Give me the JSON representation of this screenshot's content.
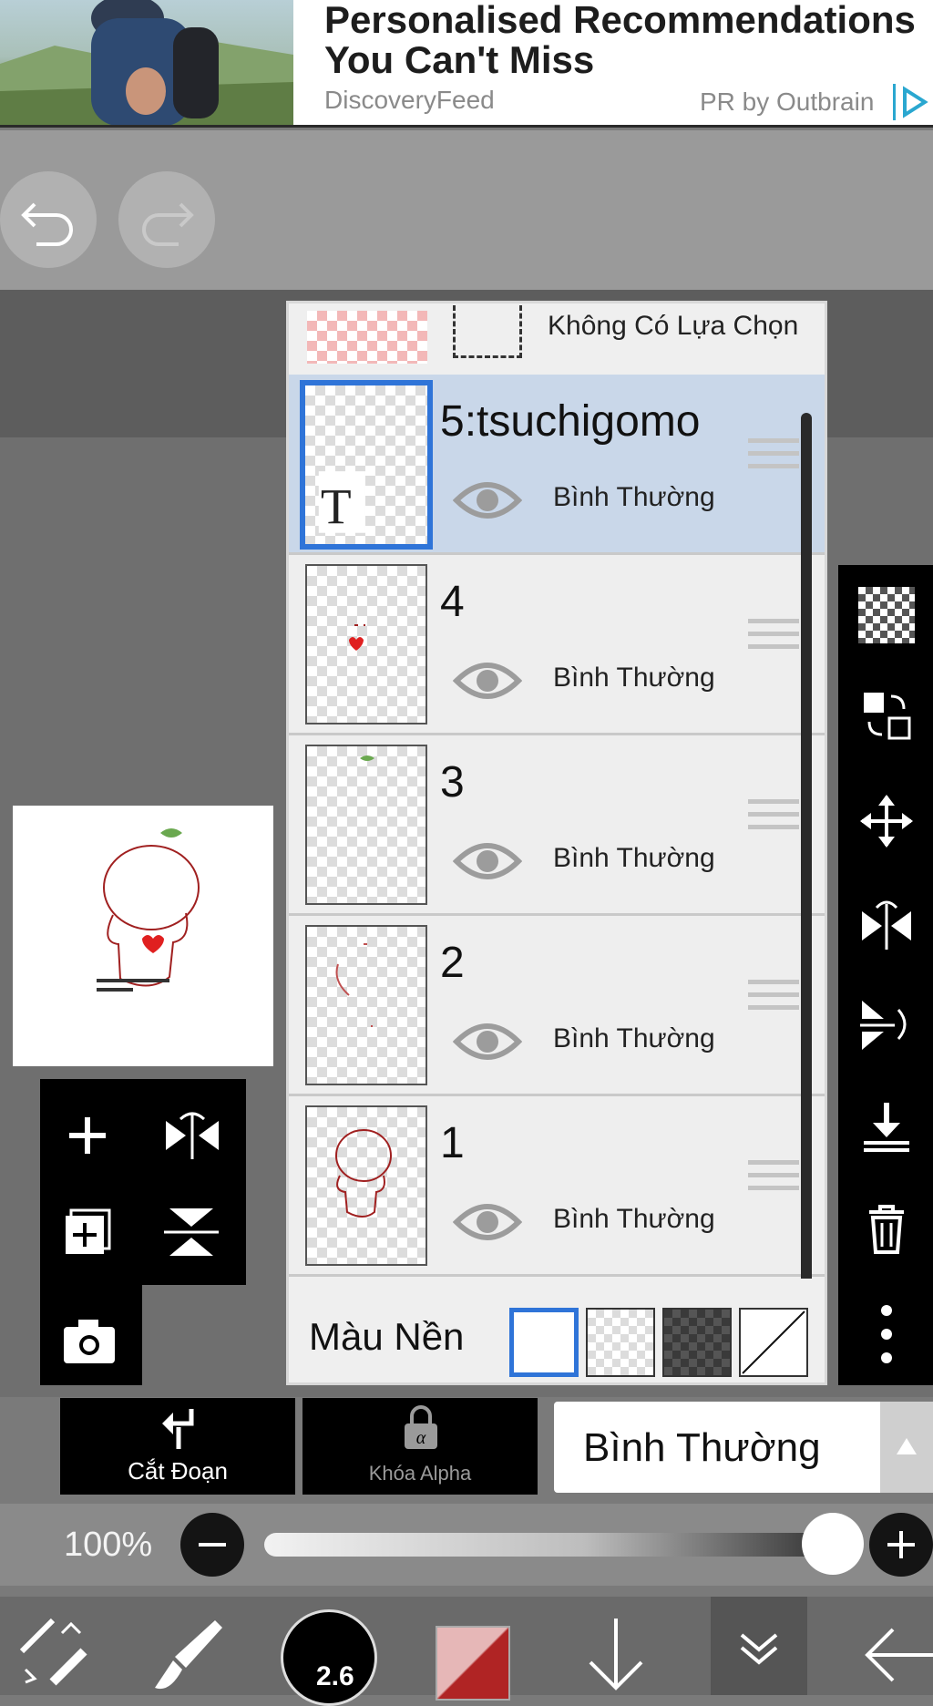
{
  "ad": {
    "title_line1": "Personalised Recommendations",
    "title_line2": "You Can't Miss",
    "source": "DiscoveryFeed",
    "sponsor": "PR by Outbrain"
  },
  "layers_panel": {
    "selection_label": "Không Có Lựa Chọn",
    "layers": [
      {
        "name": "5:tsuchigomo",
        "blend": "Bình Thường",
        "active": true
      },
      {
        "name": "4",
        "blend": "Bình Thường",
        "active": false
      },
      {
        "name": "3",
        "blend": "Bình Thường",
        "active": false
      },
      {
        "name": "2",
        "blend": "Bình Thường",
        "active": false
      },
      {
        "name": "1",
        "blend": "Bình Thường",
        "active": false
      }
    ],
    "background_label": "Màu Nền"
  },
  "bottom": {
    "clip_label": "Cắt Đoạn",
    "alpha_lock_label": "Khóa Alpha",
    "blend_mode_value": "Bình Thường",
    "opacity_label": "100%",
    "opacity_value": 1.0,
    "brush_size": "2.6"
  },
  "colors": {
    "active_layer_bg": "#c9d7e9",
    "active_border": "#2f74d8",
    "foreground_color": "#b02424"
  }
}
